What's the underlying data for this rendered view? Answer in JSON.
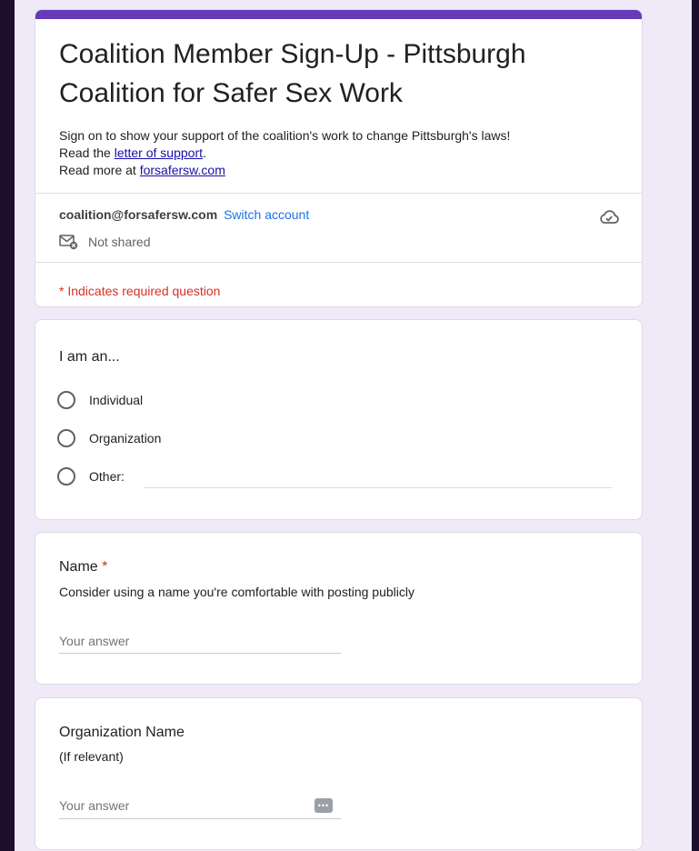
{
  "form": {
    "title": "Coalition Member Sign-Up - Pittsburgh Coalition for Safer Sex Work",
    "description": {
      "line1": "Sign on to show your support of the coalition's work to change Pittsburgh's laws!",
      "line2_prefix": "Read the ",
      "line2_link": "letter of support",
      "line2_suffix": ".",
      "line3_prefix": "Read more at ",
      "line3_link": "forsafersw.com"
    },
    "account": {
      "email": "coalition@forsafersw.com",
      "switch_label": "Switch account",
      "not_shared": "Not shared"
    },
    "required_note": "* Indicates required question"
  },
  "questions": {
    "type": {
      "title": "I am an...",
      "options": [
        "Individual",
        "Organization",
        "Other:"
      ]
    },
    "name": {
      "title": "Name",
      "required_mark": "*",
      "hint": "Consider using a name you're comfortable with posting publicly",
      "placeholder": "Your answer"
    },
    "org_name": {
      "title": "Organization Name",
      "hint": "(If relevant)",
      "placeholder": "Your answer"
    }
  },
  "colors": {
    "accent": "#673ab7",
    "link": "#1a73e8",
    "required": "#d93025"
  }
}
